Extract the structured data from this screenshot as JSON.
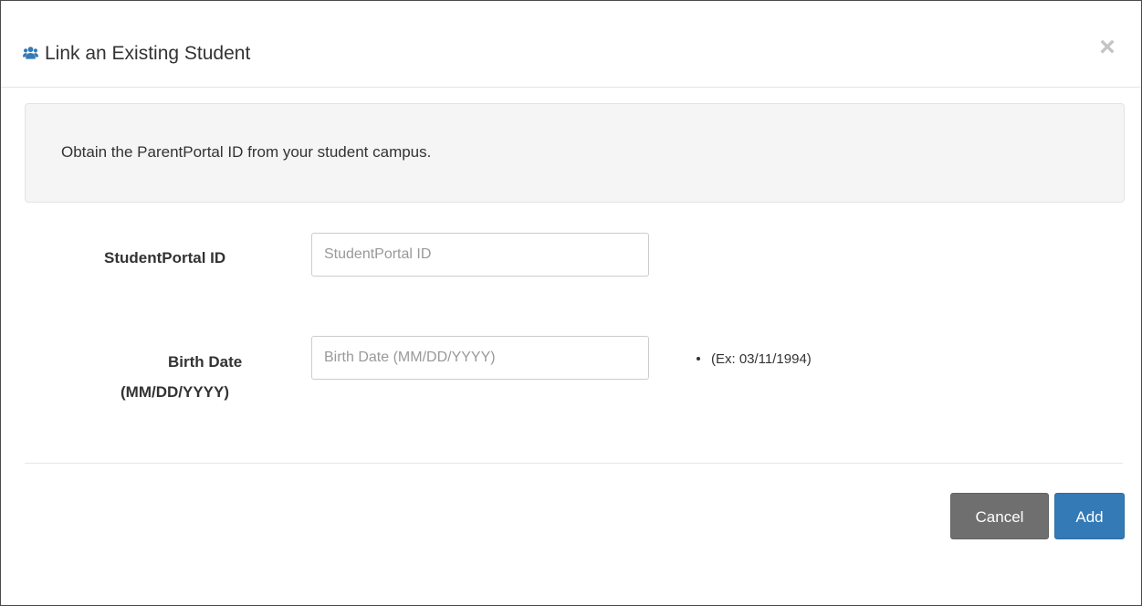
{
  "dialog": {
    "title": "Link an Existing Student",
    "close_glyph": "×",
    "header_icon": "users-icon"
  },
  "info": {
    "text": "Obtain the ParentPortal ID from your student campus."
  },
  "form": {
    "student_id": {
      "label": "StudentPortal ID",
      "value": "",
      "placeholder": "StudentPortal ID"
    },
    "birth_date": {
      "label_line1": "Birth Date",
      "label_line2": "(MM/DD/YYYY)",
      "value": "",
      "placeholder": "Birth Date (MM/DD/YYYY)",
      "hint": "(Ex: 03/11/1994)"
    }
  },
  "footer": {
    "cancel_label": "Cancel",
    "add_label": "Add"
  },
  "colors": {
    "primary": "#337ab7",
    "secondary": "#6f6f6f",
    "icon": "#337ab7",
    "well_background": "#f5f5f5"
  }
}
